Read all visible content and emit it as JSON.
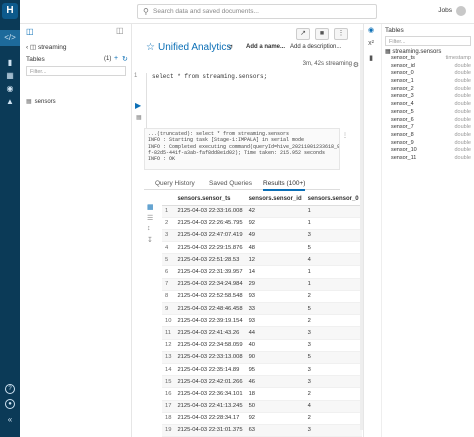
{
  "topbar": {
    "search_placeholder": "Search data and saved documents...",
    "user": "Jobs"
  },
  "assist": {
    "breadcrumb": "streaming",
    "tables_label": "Tables",
    "tables_count": "(1)",
    "filter_placeholder": "Filter...",
    "table_name": "sensors"
  },
  "editor": {
    "title": "Unified Analytics",
    "add_name": "Add a name...",
    "add_description": "Add a description...",
    "meta": "3m, 42s streaming",
    "line_number": "1",
    "query": "select * from streaming.sensors;"
  },
  "log": [
    "...(truncated): select * from streaming.sensors",
    "INFO  : Starting task [Stage-1:IMPALA] in serial mode",
    "INFO  : Completed executing command(queryId=hive_20211001233618_99fcaa5",
    "f-82d5-441f-a3ab-faf8dd8e1d02); Time taken: 215.952 seconds",
    "INFO  : OK"
  ],
  "tabs": [
    "Query History",
    "Saved Queries",
    "Results (100+)"
  ],
  "results": {
    "columns": [
      "",
      "sensors.sensor_ts",
      "sensors.sensor_id",
      "sensors.sensor_0"
    ],
    "rows": [
      [
        "1",
        "2125-04-03 22:33:16.008",
        "42",
        "1"
      ],
      [
        "2",
        "2125-04-03 22:26:45.795",
        "92",
        "1"
      ],
      [
        "3",
        "2125-04-03 22:47:07.419",
        "49",
        "3"
      ],
      [
        "4",
        "2125-04-03 22:29:15.876",
        "48",
        "5"
      ],
      [
        "5",
        "2125-04-03 22:51:28.53",
        "12",
        "4"
      ],
      [
        "6",
        "2125-04-03 22:31:39.957",
        "14",
        "1"
      ],
      [
        "7",
        "2125-04-03 22:34:24.984",
        "29",
        "1"
      ],
      [
        "8",
        "2125-04-03 22:52:58.548",
        "93",
        "2"
      ],
      [
        "9",
        "2125-04-03 22:48:46.458",
        "33",
        "5"
      ],
      [
        "10",
        "2125-04-03 22:39:19.154",
        "93",
        "2"
      ],
      [
        "11",
        "2125-04-03 22:41:43.26",
        "44",
        "3"
      ],
      [
        "12",
        "2125-04-03 22:34:58.059",
        "40",
        "3"
      ],
      [
        "13",
        "2125-04-03 22:33:13.008",
        "90",
        "5"
      ],
      [
        "14",
        "2125-04-03 22:35:14.89",
        "95",
        "3"
      ],
      [
        "15",
        "2125-04-03 22:42:01.266",
        "46",
        "3"
      ],
      [
        "16",
        "2125-04-03 22:36:34.101",
        "18",
        "2"
      ],
      [
        "17",
        "2125-04-03 22:41:13.245",
        "50",
        "4"
      ],
      [
        "18",
        "2125-04-03 22:28:34.17",
        "92",
        "2"
      ],
      [
        "19",
        "2125-04-03 22:31:01.375",
        "63",
        "3"
      ]
    ]
  },
  "right_panel": {
    "title": "Tables",
    "filter_placeholder": "Filter...",
    "table": "streaming.sensors",
    "columns": [
      {
        "name": "sensor_ts",
        "type": "timestamp"
      },
      {
        "name": "sensor_id",
        "type": "double"
      },
      {
        "name": "sensor_0",
        "type": "double"
      },
      {
        "name": "sensor_1",
        "type": "double"
      },
      {
        "name": "sensor_2",
        "type": "double"
      },
      {
        "name": "sensor_3",
        "type": "double"
      },
      {
        "name": "sensor_4",
        "type": "double"
      },
      {
        "name": "sensor_5",
        "type": "double"
      },
      {
        "name": "sensor_6",
        "type": "double"
      },
      {
        "name": "sensor_7",
        "type": "double"
      },
      {
        "name": "sensor_8",
        "type": "double"
      },
      {
        "name": "sensor_9",
        "type": "double"
      },
      {
        "name": "sensor_10",
        "type": "double"
      },
      {
        "name": "sensor_11",
        "type": "double"
      }
    ]
  }
}
